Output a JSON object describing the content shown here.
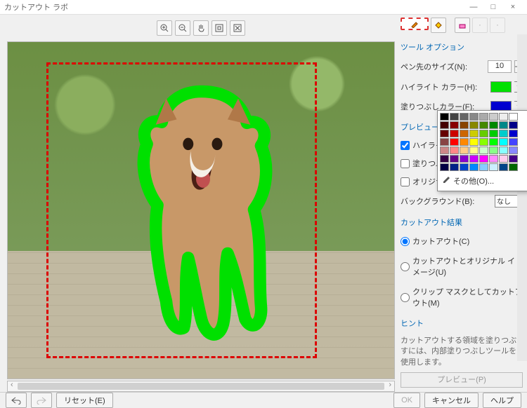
{
  "window": {
    "title": "カットアウト ラボ"
  },
  "sidebar": {
    "group_tool_options": "ツール オプション",
    "pen_size_label": "ペン先のサイズ(N):",
    "pen_size_value": "10",
    "highlight_color_label": "ハイライト カラー(H):",
    "fill_color_label": "塗りつぶしカラー(F):",
    "group_preview": "プレビューの設定",
    "chk_show_highlight": "ハイライトの表示(O)",
    "chk_show_fill": "塗りつぶしの表示(W)",
    "chk_show_original": "オリジナル イメージの表示",
    "background_label": "バックグラウンド(B):",
    "background_value": "なし",
    "group_result": "カットアウト結果",
    "radio_cutout": "カットアウト(C)",
    "radio_cutout_orig": "カットアウトとオリジナル イメージ(U)",
    "radio_clipmask": "クリップ マスクとしてカットアウト(M)",
    "group_hint": "ヒント",
    "hint_text": "カットアウトする領域を塗りつぶすには、内部塗りつぶしツールを使用します。",
    "preview_btn": "プレビュー(P)"
  },
  "footer": {
    "reset": "リセット(E)",
    "ok": "OK",
    "cancel": "キャンセル",
    "help": "ヘルプ"
  },
  "palette": {
    "more": "その他(O)...",
    "colors": [
      "#000",
      "#444",
      "#666",
      "#888",
      "#aaa",
      "#ccc",
      "#eee",
      "#fff",
      "#400",
      "#800",
      "#840",
      "#880",
      "#480",
      "#080",
      "#088",
      "#008",
      "#600",
      "#c00",
      "#c60",
      "#cc0",
      "#6c0",
      "#0c0",
      "#0cc",
      "#00c",
      "#844",
      "#f00",
      "#f80",
      "#ff0",
      "#8f0",
      "#0f0",
      "#0ff",
      "#44f",
      "#c88",
      "#f88",
      "#fc8",
      "#ff8",
      "#cfc",
      "#8f8",
      "#8ff",
      "#88f",
      "#304",
      "#608",
      "#80c",
      "#c0f",
      "#f0f",
      "#f8f",
      "#fce",
      "#408",
      "#004",
      "#028",
      "#04c",
      "#08f",
      "#8cf",
      "#cef",
      "#048",
      "#060"
    ]
  }
}
